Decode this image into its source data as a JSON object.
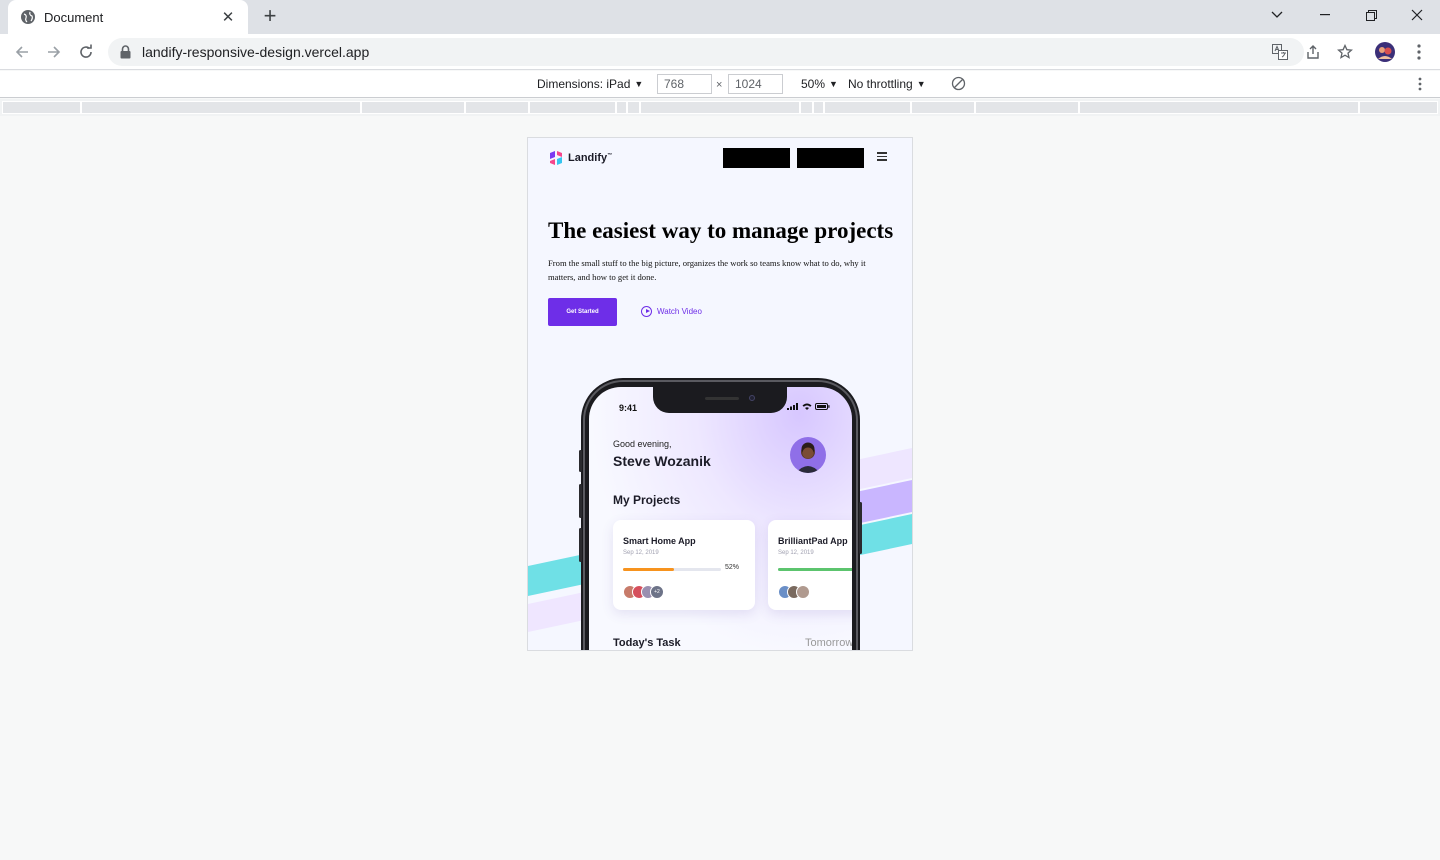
{
  "browser": {
    "tab_title": "Document",
    "url": "landify-responsive-design.vercel.app"
  },
  "devtools": {
    "dimensions_label": "Dimensions: iPad",
    "width": "768",
    "times": "×",
    "height": "1024",
    "zoom": "50%",
    "throttling": "No throttling"
  },
  "site": {
    "logo_text": "Landify",
    "logo_tm": "™",
    "hero_title": "The easiest way to manage projects",
    "hero_subtitle": "From the small stuff to the big picture, organizes the work so teams know what to do, why it matters, and how to get it done.",
    "cta_primary": "Get Started",
    "cta_secondary": "Watch Video"
  },
  "phone": {
    "time": "9:41",
    "greeting": "Good evening,",
    "user_name": "Steve Wozanik",
    "projects_title": "My Projects",
    "cards": [
      {
        "title": "Smart Home App",
        "date": "Sep 12, 2019",
        "progress": 0.52,
        "progress_label": "52%",
        "color": "#f7931e",
        "more": "+2"
      },
      {
        "title": "BrilliantPad App",
        "date": "Sep 12, 2019",
        "progress": 1.0,
        "progress_label": "",
        "color": "#5cc46e"
      }
    ],
    "tasks_title": "Today's Task",
    "tomorrow": "Tomorrow"
  },
  "colors": {
    "brand_purple": "#6e2ee8",
    "stripe_cyan": "#6fe0e6",
    "stripe_lavender": "#c9b6ff"
  }
}
